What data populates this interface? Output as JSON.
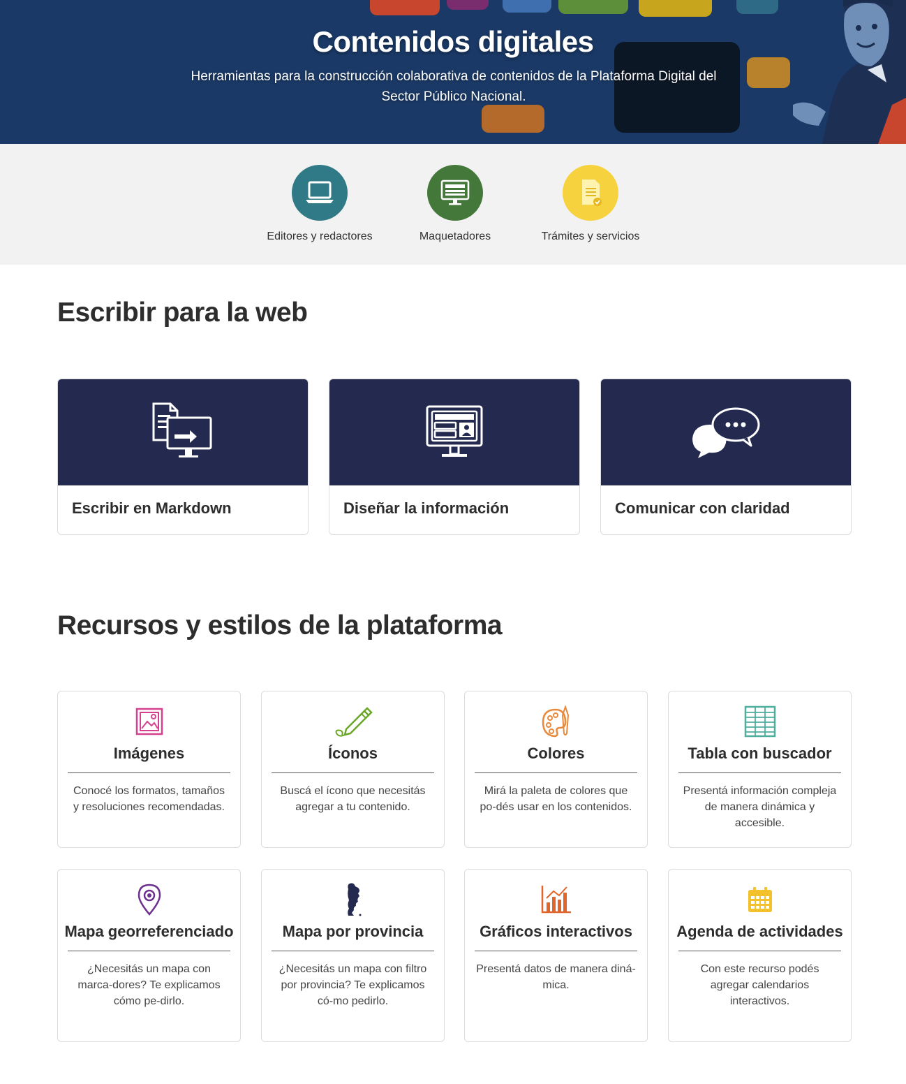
{
  "hero": {
    "title": "Contenidos digitales",
    "subtitle": "Herramientas para la construcción colaborativa de contenidos de la Plataforma Digital del Sector Público Nacional."
  },
  "roles": [
    {
      "label": "Editores y redactores",
      "icon": "laptop-icon",
      "color": "#2f7a86"
    },
    {
      "label": "Maquetadores",
      "icon": "monitor-layout-icon",
      "color": "#44783a"
    },
    {
      "label": "Trámites y servicios",
      "icon": "document-check-icon",
      "color": "#f6d23f"
    }
  ],
  "sections": {
    "write": {
      "title": "Escribir para la web",
      "cards": [
        {
          "title": "Escribir en Markdown",
          "icon": "document-to-monitor-icon"
        },
        {
          "title": "Diseñar la información",
          "icon": "monitor-layout-icon"
        },
        {
          "title": "Comunicar con claridad",
          "icon": "speech-bubbles-icon"
        }
      ]
    },
    "resources": {
      "title": "Recursos y estilos de la plataforma",
      "cards": [
        {
          "title": "Imágenes",
          "desc": "Conocé los formatos, tamaños y resoluciones recomendadas.",
          "icon": "image-icon",
          "color": "#d6418f"
        },
        {
          "title": "Íconos",
          "desc": "Buscá el ícono que necesitás agregar a tu contenido.",
          "icon": "pencil-icon",
          "color": "#6aa626"
        },
        {
          "title": "Colores",
          "desc": "Mirá la paleta de colores que po-dés usar en los contenidos.",
          "icon": "palette-icon",
          "color": "#e8893b"
        },
        {
          "title": "Tabla con buscador",
          "desc": "Presentá información compleja de manera dinámica y accesible.",
          "icon": "table-icon",
          "color": "#4fae9e"
        },
        {
          "title": "Mapa georreferenciado",
          "desc": "¿Necesitás un mapa con marca-dores? Te explicamos cómo pe-dirlo.",
          "icon": "map-pin-icon",
          "color": "#6b2f8f"
        },
        {
          "title": "Mapa por provincia",
          "desc": "¿Necesitás un mapa con filtro por provincia? Te explicamos có-mo pedirlo.",
          "icon": "argentina-map-icon",
          "color": "#242a4f"
        },
        {
          "title": "Gráficos interactivos",
          "desc": "Presentá datos de manera diná-mica.",
          "icon": "bar-chart-icon",
          "color": "#e2662a"
        },
        {
          "title": "Agenda de actividades",
          "desc": "Con este recurso podés agregar calendarios interactivos.",
          "icon": "calendar-icon",
          "color": "#f2c12c"
        }
      ]
    }
  }
}
